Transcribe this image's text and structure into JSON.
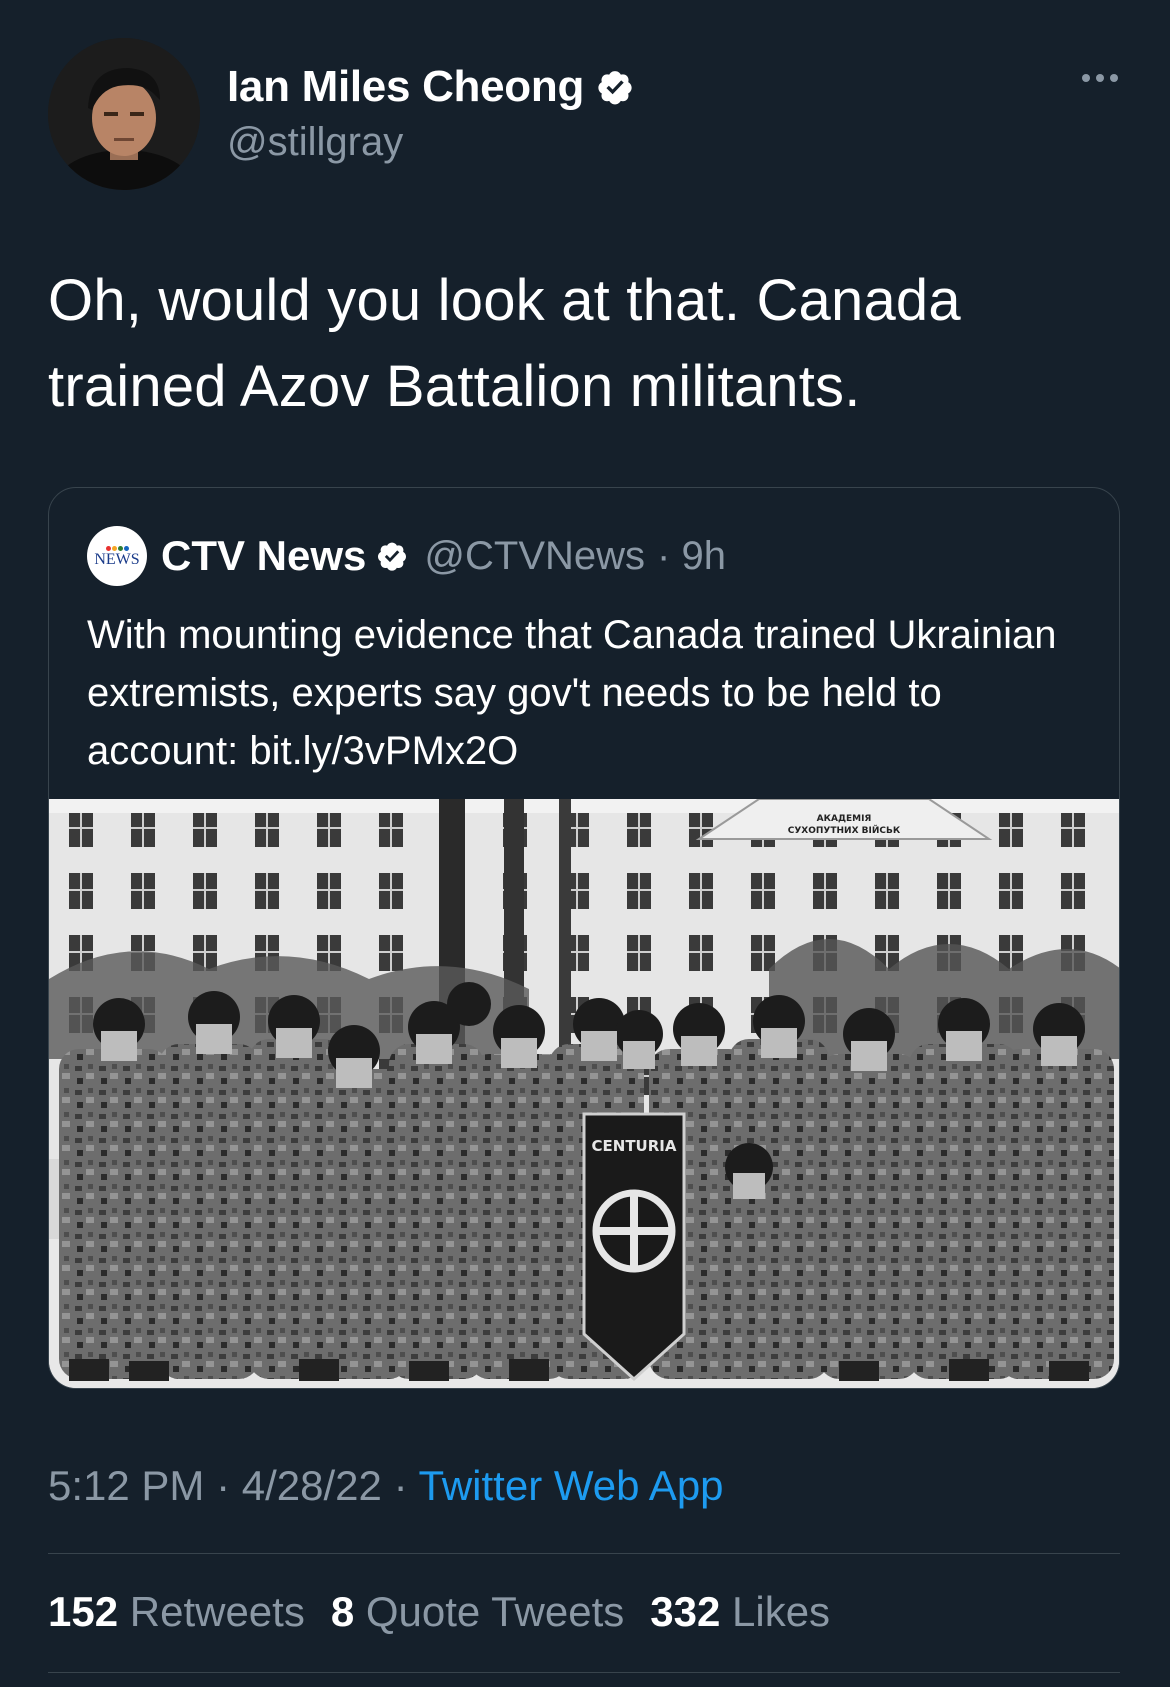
{
  "author": {
    "display_name": "Ian Miles Cheong",
    "handle": "@stillgray",
    "avatar_icon": "profile-photo"
  },
  "tweet": {
    "text": "Oh, would you look at that. Canada trained Azov Battalion militants."
  },
  "quoted_tweet": {
    "avatar_label": "NEWS",
    "display_name": "CTV News",
    "handle": "@CTVNews",
    "time": "· 9h",
    "text": "With mounting evidence that Canada trained Ukrainian extremists, experts say gov't needs to be held to account: bit.ly/3vPMx2O",
    "image": {
      "building_sign_line1": "АКАДЕМІЯ",
      "building_sign_line2": "СУХОПУТНИХ ВІЙСЬК",
      "banner_text": "CENTURIA"
    }
  },
  "meta": {
    "time": "5:12 PM",
    "date": "4/28/22",
    "separator": "·",
    "app": "Twitter Web App"
  },
  "stats": {
    "retweets_count": "152",
    "retweets_label": "Retweets",
    "quotes_count": "8",
    "quotes_label": "Quote Tweets",
    "likes_count": "332",
    "likes_label": "Likes"
  },
  "colors": {
    "background": "#15202b",
    "secondary_text": "#8b98a5",
    "link": "#1d9bf0",
    "border": "#38444d"
  }
}
